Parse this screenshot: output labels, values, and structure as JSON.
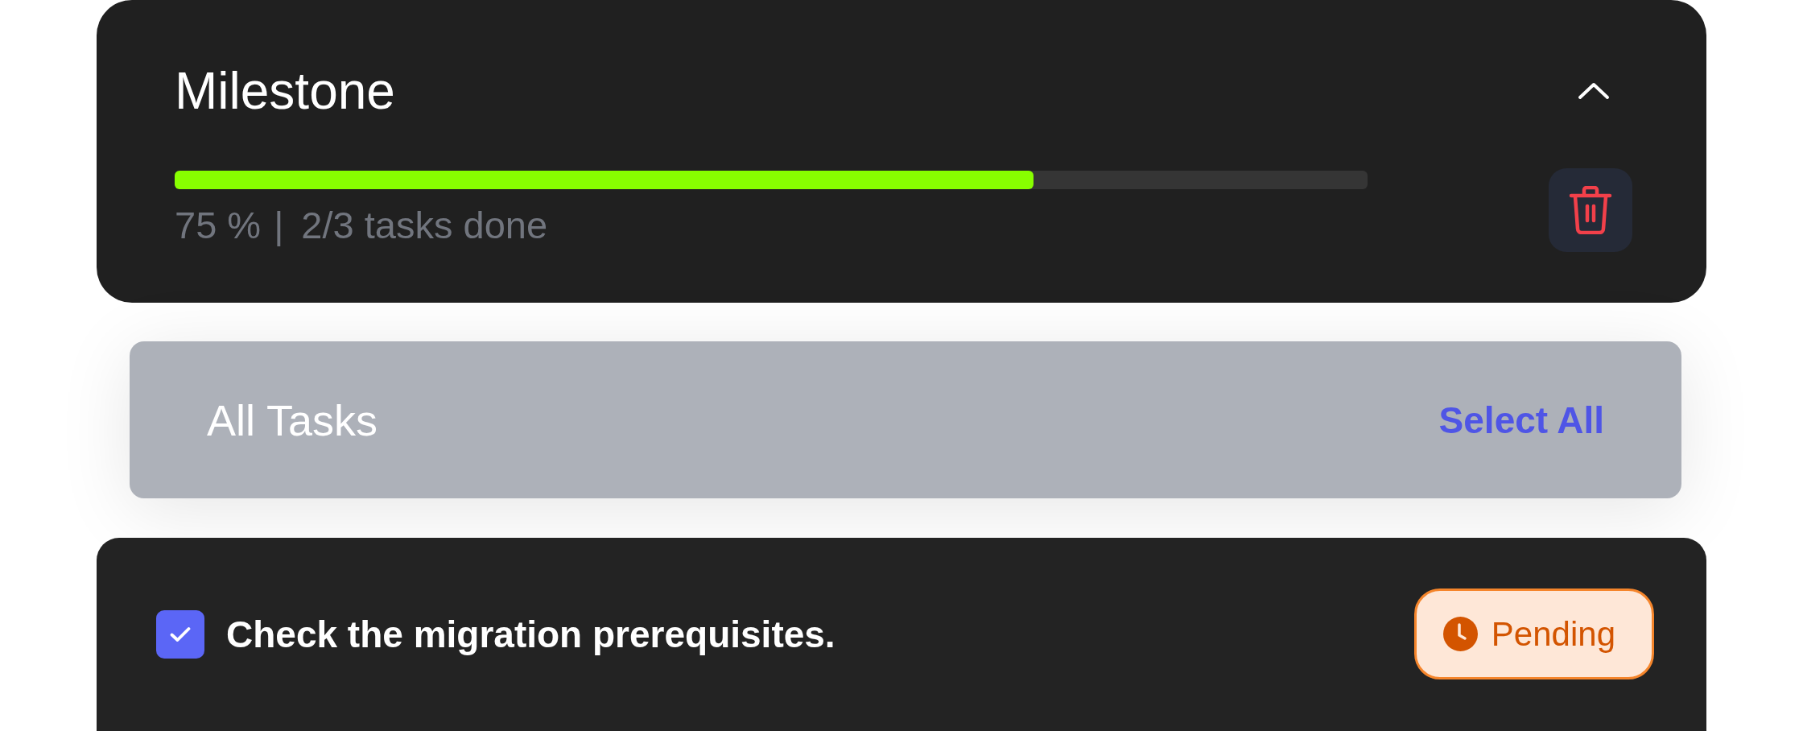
{
  "milestone": {
    "title": "Milestone",
    "expanded": true,
    "progress": {
      "level": 0.72,
      "percent": "75 %",
      "separator": "|",
      "tasks_done": "2/3 tasks done"
    }
  },
  "task_list_header": {
    "title": "All Tasks",
    "action": "Select All"
  },
  "tasks": [
    {
      "label": "Check the migration prerequisites.",
      "checked": true,
      "status": {
        "kind": "pending",
        "label": "Pending"
      }
    }
  ]
}
